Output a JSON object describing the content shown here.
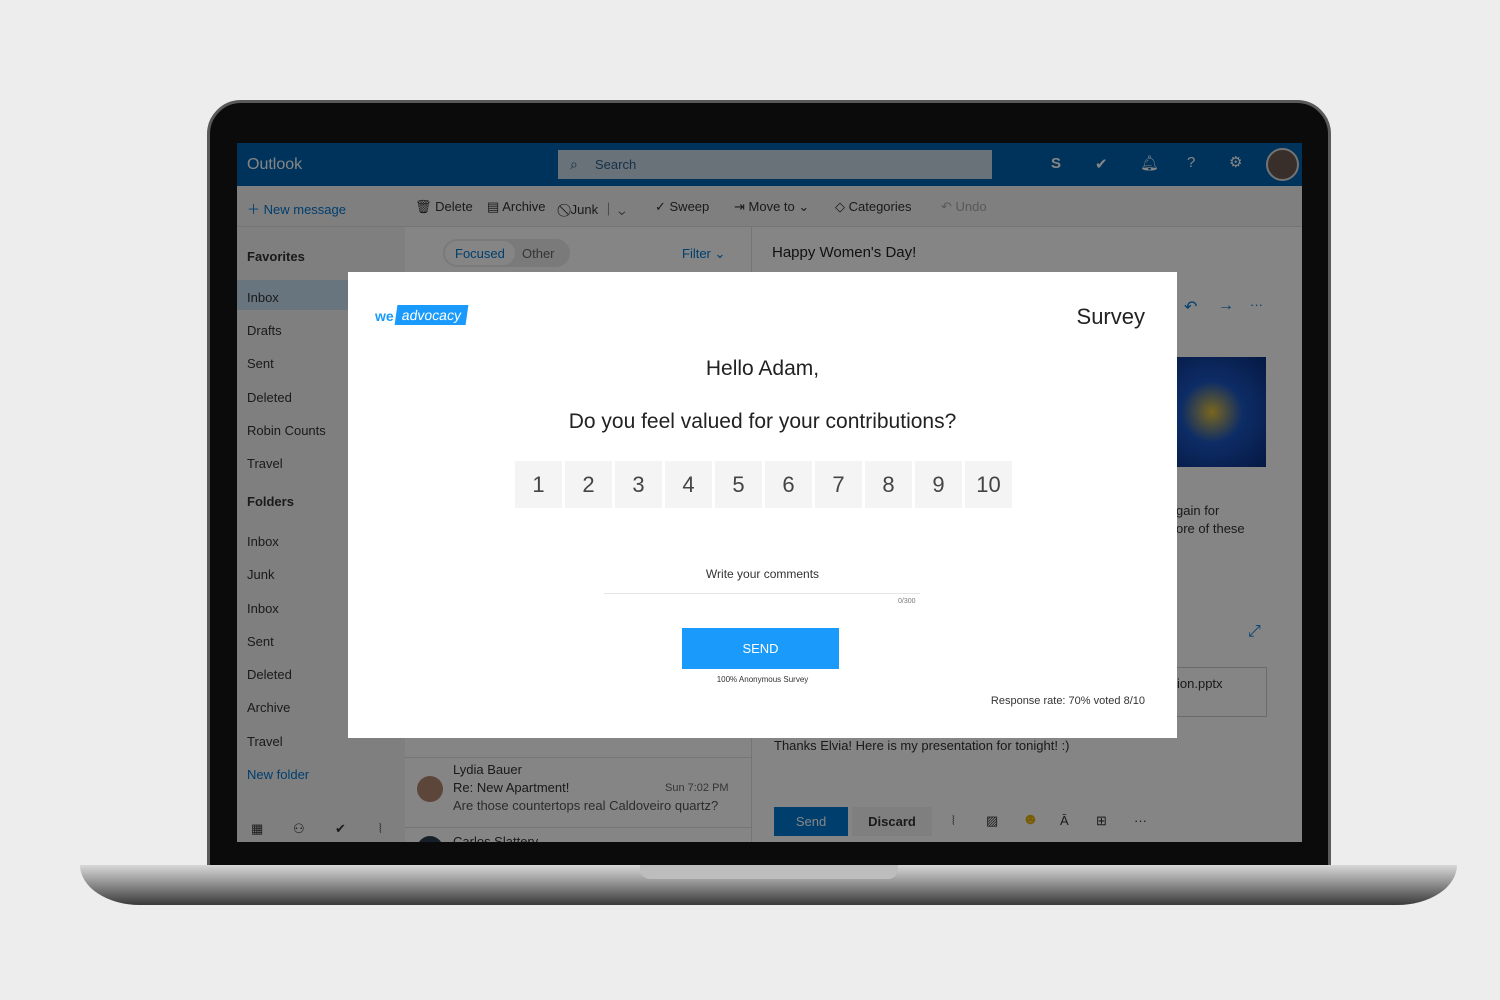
{
  "outlook": {
    "app_title": "Outlook",
    "search_placeholder": "Search",
    "toolbar": {
      "new_message": "New message",
      "delete": "Delete",
      "archive": "Archive",
      "junk": "Junk",
      "sweep": "Sweep",
      "move_to": "Move to",
      "categories": "Categories",
      "undo": "Undo"
    },
    "nav": {
      "favorites": "Favorites",
      "favorite_items": [
        "Inbox",
        "Drafts",
        "Sent",
        "Deleted",
        "Robin Counts",
        "Travel"
      ],
      "folders": "Folders",
      "folder_items": [
        "Inbox",
        "Junk",
        "Inbox",
        "Sent",
        "Deleted",
        "Archive",
        "Travel"
      ],
      "new_folder": "New folder"
    },
    "list": {
      "tabs": [
        "Focused",
        "Other"
      ],
      "filter": "Filter",
      "messages": [
        {
          "sender": "Lydia Bauer",
          "subject": "Re: New Apartment!",
          "time": "Sun 7:02 PM",
          "preview": "Are those countertops real Caldoveiro quartz?"
        },
        {
          "sender": "Carlos Slattery"
        }
      ]
    },
    "reading": {
      "subject": "Happy Women's Day!",
      "body_fragment_1": "gain for",
      "body_fragment_2": "ore of these",
      "attachment": "ion.pptx",
      "reply_text": "Thanks Elvia! Here is my presentation for tonight! :)",
      "send": "Send",
      "discard": "Discard"
    },
    "accent": "#0078d4"
  },
  "survey": {
    "logo": "we advocacy",
    "title": "Survey",
    "greeting": "Hello Adam,",
    "question": "Do you feel valued for your contributions?",
    "scale": [
      "1",
      "2",
      "3",
      "4",
      "5",
      "6",
      "7",
      "8",
      "9",
      "10"
    ],
    "comment_placeholder": "Write your comments",
    "char_count": "0/300",
    "send": "SEND",
    "anonymous": "100% Anonymous Survey",
    "response_rate": "Response rate: 70% voted 8/10",
    "accent": "#1a9bfc"
  }
}
